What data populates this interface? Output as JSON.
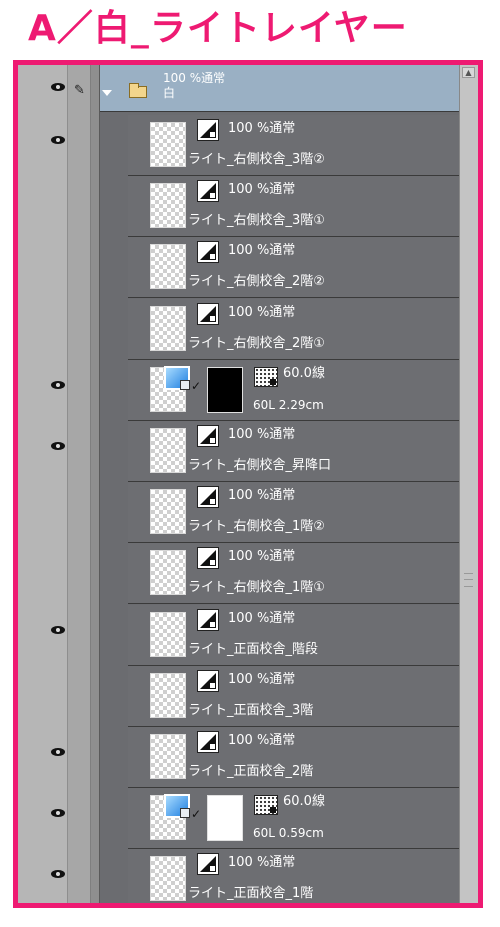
{
  "header": {
    "title": "A／白_ライトレイヤー"
  },
  "folder": {
    "opacity_mode": "100 %通常",
    "name": "白"
  },
  "colors": {
    "frame_border": "#ee1a72",
    "panel_bg": "#6b6c70",
    "folder_row": "#9ab0c4"
  },
  "layers": [
    {
      "kind": "raster",
      "mode": "100 %通常",
      "name": "ライト_右側校舎_3階②",
      "visible": true
    },
    {
      "kind": "raster",
      "mode": "100 %通常",
      "name": "ライト_右側校舎_3階①",
      "visible": false
    },
    {
      "kind": "raster",
      "mode": "100 %通常",
      "name": "ライト_右側校舎_2階②",
      "visible": false
    },
    {
      "kind": "raster",
      "mode": "100 %通常",
      "name": "ライト_右側校舎_2階①",
      "visible": false
    },
    {
      "kind": "vector",
      "value": "60.0線",
      "info": "60L 2.29cm",
      "mask": "black",
      "visible": true
    },
    {
      "kind": "raster",
      "mode": "100 %通常",
      "name": "ライト_右側校舎_昇降口",
      "visible": true
    },
    {
      "kind": "raster",
      "mode": "100 %通常",
      "name": "ライト_右側校舎_1階②",
      "visible": false
    },
    {
      "kind": "raster",
      "mode": "100 %通常",
      "name": "ライト_右側校舎_1階①",
      "visible": false
    },
    {
      "kind": "raster",
      "mode": "100 %通常",
      "name": "ライト_正面校舎_階段",
      "visible": true
    },
    {
      "kind": "raster",
      "mode": "100 %通常",
      "name": "ライト_正面校舎_3階",
      "visible": false
    },
    {
      "kind": "raster",
      "mode": "100 %通常",
      "name": "ライト_正面校舎_2階",
      "visible": true
    },
    {
      "kind": "vector",
      "value": "60.0線",
      "info": "60L 0.59cm",
      "mask": "white",
      "visible": true
    },
    {
      "kind": "raster",
      "mode": "100 %通常",
      "name": "ライト_正面校舎_1階",
      "visible": true
    }
  ]
}
